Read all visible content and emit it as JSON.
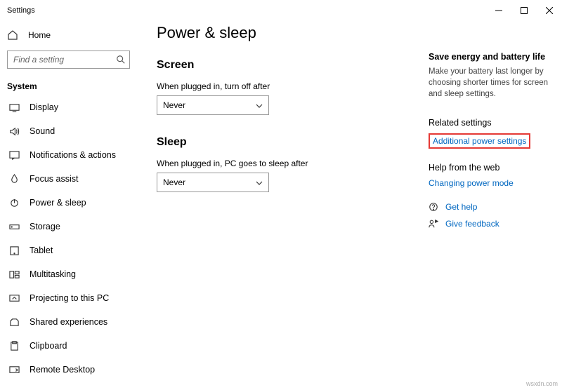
{
  "window": {
    "title": "Settings"
  },
  "sidebar": {
    "home": "Home",
    "search_placeholder": "Find a setting",
    "category": "System",
    "items": [
      {
        "label": "Display"
      },
      {
        "label": "Sound"
      },
      {
        "label": "Notifications & actions"
      },
      {
        "label": "Focus assist"
      },
      {
        "label": "Power & sleep"
      },
      {
        "label": "Storage"
      },
      {
        "label": "Tablet"
      },
      {
        "label": "Multitasking"
      },
      {
        "label": "Projecting to this PC"
      },
      {
        "label": "Shared experiences"
      },
      {
        "label": "Clipboard"
      },
      {
        "label": "Remote Desktop"
      }
    ]
  },
  "main": {
    "title": "Power & sleep",
    "screen": {
      "heading": "Screen",
      "label": "When plugged in, turn off after",
      "value": "Never"
    },
    "sleep": {
      "heading": "Sleep",
      "label": "When plugged in, PC goes to sleep after",
      "value": "Never"
    }
  },
  "right": {
    "tip_head": "Save energy and battery life",
    "tip_text": "Make your battery last longer by choosing shorter times for screen and sleep settings.",
    "related_head": "Related settings",
    "related_link": "Additional power settings",
    "help_head": "Help from the web",
    "help_link": "Changing power mode",
    "get_help": "Get help",
    "feedback": "Give feedback"
  },
  "watermark": "wsxdn.com"
}
